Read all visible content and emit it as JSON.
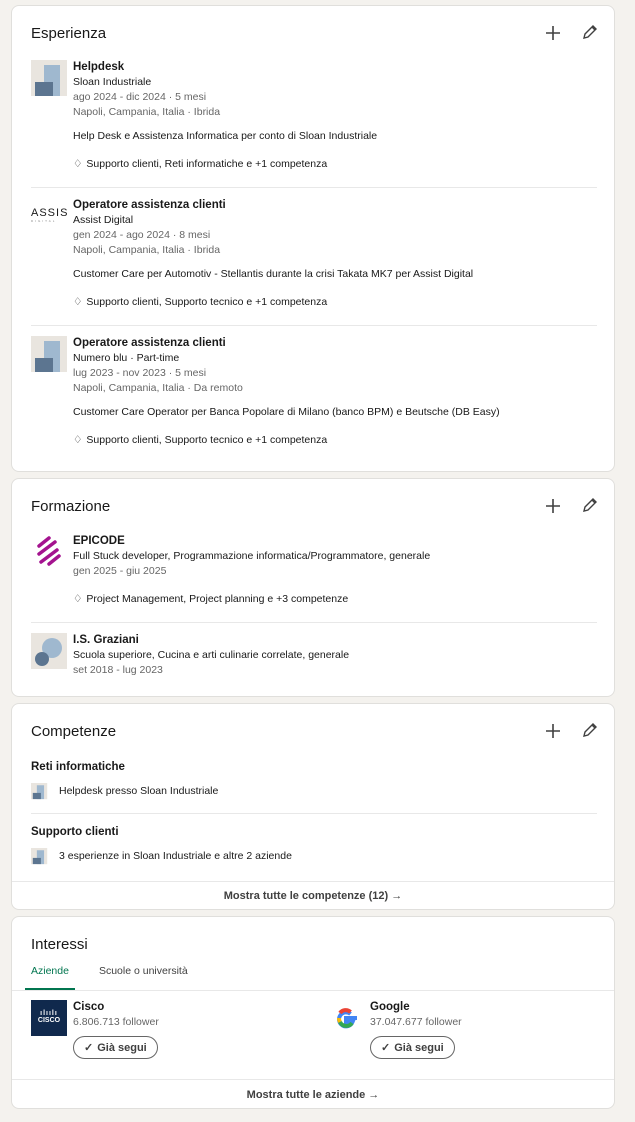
{
  "experience": {
    "title": "Esperienza",
    "items": [
      {
        "title": "Helpdesk",
        "company": "Sloan Industriale",
        "dates": "ago 2024 - dic 2024 · 5 mesi",
        "location": "Napoli, Campania, Italia · Ibrida",
        "description": "Help Desk e Assistenza Informatica per conto di Sloan Industriale",
        "skills": "Supporto clienti, Reti informatiche e +1 competenza"
      },
      {
        "title": "Operatore assistenza clienti",
        "company": "Assist Digital",
        "dates": "gen 2024 - ago 2024 · 8 mesi",
        "location": "Napoli, Campania, Italia · Ibrida",
        "description": "Customer Care per Automotiv - Stellantis durante la crisi Takata MK7 per Assist Digital",
        "skills": "Supporto clienti, Supporto tecnico e +1 competenza",
        "logo_text": "ASSIST",
        "logo_sub": "DIGITAL"
      },
      {
        "title": "Operatore assistenza clienti",
        "company": "Numero blu · Part-time",
        "dates": "lug 2023 - nov 2023 · 5 mesi",
        "location": "Napoli, Campania, Italia · Da remoto",
        "description": "Customer Care Operator per Banca Popolare di Milano (banco BPM) e Beutsche (DB Easy)",
        "skills": "Supporto clienti, Supporto tecnico e +1 competenza"
      }
    ]
  },
  "education": {
    "title": "Formazione",
    "items": [
      {
        "school": "EPICODE",
        "degree": "Full Stuck developer, Programmazione informatica/Programmatore, generale",
        "dates": "gen 2025 - giu 2025",
        "skills": "Project Management, Project planning e +3 competenze"
      },
      {
        "school": "I.S. Graziani",
        "degree": "Scuola superiore, Cucina e arti culinarie correlate, generale",
        "dates": "set 2018 - lug 2023"
      }
    ]
  },
  "skills": {
    "title": "Competenze",
    "items": [
      {
        "name": "Reti informatiche",
        "context": "Helpdesk presso Sloan Industriale"
      },
      {
        "name": "Supporto clienti",
        "context": "3 esperienze in Sloan Industriale e altre 2 aziende"
      }
    ],
    "show_all": "Mostra tutte le competenze (12) →"
  },
  "interests": {
    "title": "Interessi",
    "tabs": [
      "Aziende",
      "Scuole o università"
    ],
    "active_tab": "Aziende",
    "accent": "#01754f",
    "companies": [
      {
        "name": "Cisco",
        "followers": "6.806.713 follower",
        "button": "Già segui",
        "logo_text": "CISCO"
      },
      {
        "name": "Google",
        "followers": "37.047.677 follower",
        "button": "Già segui"
      }
    ],
    "show_all": "Mostra tutte le aziende →"
  }
}
